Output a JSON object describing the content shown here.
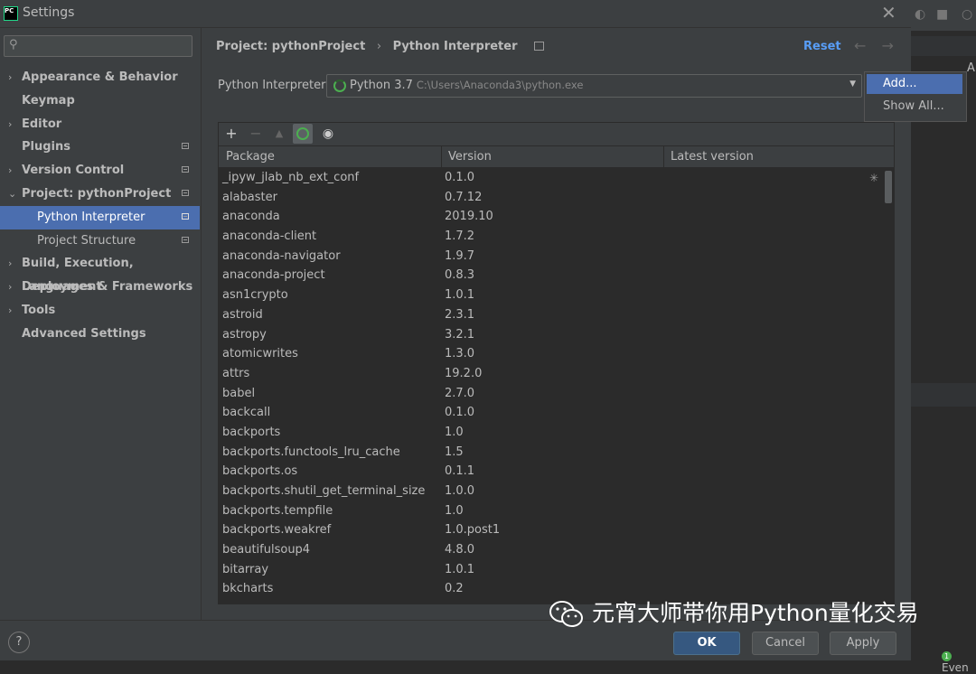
{
  "window": {
    "title": "Settings",
    "logo_text": "PC"
  },
  "sidebar": {
    "search": {
      "value": "",
      "placeholder": ""
    },
    "items": [
      {
        "label": "Appearance & Behavior",
        "expandable": true,
        "project_scoped": false
      },
      {
        "label": "Keymap",
        "expandable": false,
        "project_scoped": false
      },
      {
        "label": "Editor",
        "expandable": true,
        "project_scoped": false
      },
      {
        "label": "Plugins",
        "expandable": false,
        "project_scoped": true
      },
      {
        "label": "Version Control",
        "expandable": true,
        "project_scoped": true
      },
      {
        "label": "Project: pythonProject",
        "expandable": true,
        "expanded": true,
        "project_scoped": true
      },
      {
        "label": "Python Interpreter",
        "sub": true,
        "selected": true,
        "project_scoped": true
      },
      {
        "label": "Project Structure",
        "sub": true,
        "project_scoped": true
      },
      {
        "label": "Build, Execution, Deployment",
        "expandable": true,
        "project_scoped": false
      },
      {
        "label": "Languages & Frameworks",
        "expandable": true,
        "project_scoped": false
      },
      {
        "label": "Tools",
        "expandable": true,
        "project_scoped": false
      },
      {
        "label": "Advanced Settings",
        "expandable": false,
        "project_scoped": false
      }
    ]
  },
  "header": {
    "breadcrumb_project": "Project: pythonProject",
    "breadcrumb_separator": "›",
    "breadcrumb_page": "Python Interpreter",
    "reset_label": "Reset",
    "back_arrow": "←",
    "forward_arrow": "→"
  },
  "interpreter": {
    "label": "Python Interpreter:",
    "name": "Python 3.7",
    "path": "C:\\Users\\Anaconda3\\python.exe"
  },
  "popup": {
    "items": [
      "Add...",
      "Show All..."
    ],
    "selected": "Add..."
  },
  "table": {
    "columns": [
      "Package",
      "Version",
      "Latest version"
    ],
    "rows": [
      [
        "_ipyw_jlab_nb_ext_conf",
        "0.1.0"
      ],
      [
        "alabaster",
        "0.7.12"
      ],
      [
        "anaconda",
        "2019.10"
      ],
      [
        "anaconda-client",
        "1.7.2"
      ],
      [
        "anaconda-navigator",
        "1.9.7"
      ],
      [
        "anaconda-project",
        "0.8.3"
      ],
      [
        "asn1crypto",
        "1.0.1"
      ],
      [
        "astroid",
        "2.3.1"
      ],
      [
        "astropy",
        "3.2.1"
      ],
      [
        "atomicwrites",
        "1.3.0"
      ],
      [
        "attrs",
        "19.2.0"
      ],
      [
        "babel",
        "2.7.0"
      ],
      [
        "backcall",
        "0.1.0"
      ],
      [
        "backports",
        "1.0"
      ],
      [
        "backports.functools_lru_cache",
        "1.5"
      ],
      [
        "backports.os",
        "0.1.1"
      ],
      [
        "backports.shutil_get_terminal_size",
        "1.0.0"
      ],
      [
        "backports.tempfile",
        "1.0"
      ],
      [
        "backports.weakref",
        "1.0.post1"
      ],
      [
        "beautifulsoup4",
        "4.8.0"
      ],
      [
        "bitarray",
        "1.0.1"
      ],
      [
        "bkcharts",
        "0.2"
      ]
    ]
  },
  "footer": {
    "help_label": "?",
    "ok_label": "OK",
    "cancel_label": "Cancel",
    "apply_label": "Apply"
  },
  "background_ide": {
    "right_label": "Ar",
    "event_count": "1",
    "event_label": "Even"
  },
  "watermark": {
    "text": "元宵大师带你用Python量化交易"
  },
  "colors": {
    "selection": "#4b6eaf",
    "link": "#589df6",
    "ok_button": "#365880",
    "spinner": "#4caf50"
  }
}
